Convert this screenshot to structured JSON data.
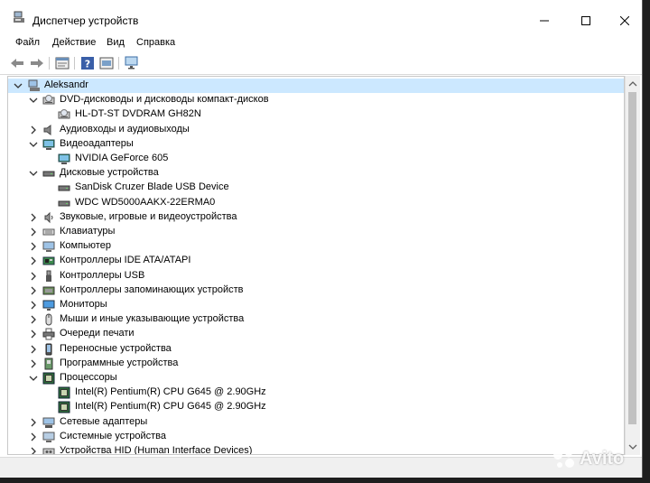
{
  "window": {
    "title": "Диспетчер устройств"
  },
  "menu": [
    "Файл",
    "Действие",
    "Вид",
    "Справка"
  ],
  "toolbar": {
    "icons": [
      "back-arrow-icon",
      "forward-arrow-icon",
      "properties-icon",
      "help-icon",
      "update-driver-icon",
      "scan-monitor-icon"
    ]
  },
  "tree": {
    "root": "Aleksandr",
    "rows": [
      {
        "label": "DVD-дисководы и дисководы компакт-дисков",
        "level": 1,
        "expanded": true,
        "icon": "dvd-drive-icon"
      },
      {
        "label": "HL-DT-ST DVDRAM GH82N",
        "level": 2,
        "icon": "dvd-drive-icon"
      },
      {
        "label": "Аудиовходы и аудиовыходы",
        "level": 1,
        "expanded": false,
        "icon": "speaker-icon"
      },
      {
        "label": "Видеоадаптеры",
        "level": 1,
        "expanded": true,
        "icon": "display-adapter-icon"
      },
      {
        "label": "NVIDIA GeForce 605",
        "level": 2,
        "icon": "display-adapter-icon"
      },
      {
        "label": "Дисковые устройства",
        "level": 1,
        "expanded": true,
        "icon": "disk-drive-icon"
      },
      {
        "label": "SanDisk Cruzer Blade USB Device",
        "level": 2,
        "icon": "disk-drive-icon"
      },
      {
        "label": "WDC WD5000AAKX-22ERMA0",
        "level": 2,
        "icon": "disk-drive-icon"
      },
      {
        "label": "Звуковые, игровые и видеоустройства",
        "level": 1,
        "expanded": false,
        "icon": "sound-icon"
      },
      {
        "label": "Клавиатуры",
        "level": 1,
        "expanded": false,
        "icon": "keyboard-icon"
      },
      {
        "label": "Компьютер",
        "level": 1,
        "expanded": false,
        "icon": "computer-icon"
      },
      {
        "label": "Контроллеры IDE ATA/ATAPI",
        "level": 1,
        "expanded": false,
        "icon": "ide-controller-icon"
      },
      {
        "label": "Контроллеры USB",
        "level": 1,
        "expanded": false,
        "icon": "usb-icon"
      },
      {
        "label": "Контроллеры запоминающих устройств",
        "level": 1,
        "expanded": false,
        "icon": "storage-controller-icon"
      },
      {
        "label": "Мониторы",
        "level": 1,
        "expanded": false,
        "icon": "monitor-icon"
      },
      {
        "label": "Мыши и иные указывающие устройства",
        "level": 1,
        "expanded": false,
        "icon": "mouse-icon"
      },
      {
        "label": "Очереди печати",
        "level": 1,
        "expanded": false,
        "icon": "printer-icon"
      },
      {
        "label": "Переносные устройства",
        "level": 1,
        "expanded": false,
        "icon": "portable-device-icon"
      },
      {
        "label": "Программные устройства",
        "level": 1,
        "expanded": false,
        "icon": "software-device-icon"
      },
      {
        "label": "Процессоры",
        "level": 1,
        "expanded": true,
        "icon": "processor-icon"
      },
      {
        "label": "Intel(R) Pentium(R) CPU G645 @ 2.90GHz",
        "level": 2,
        "icon": "processor-icon"
      },
      {
        "label": "Intel(R) Pentium(R) CPU G645 @ 2.90GHz",
        "level": 2,
        "icon": "processor-icon"
      },
      {
        "label": "Сетевые адаптеры",
        "level": 1,
        "expanded": false,
        "icon": "network-adapter-icon"
      },
      {
        "label": "Системные устройства",
        "level": 1,
        "expanded": false,
        "icon": "system-device-icon"
      },
      {
        "label": "Устройства HID (Human Interface Devices)",
        "level": 1,
        "expanded": false,
        "icon": "hid-icon"
      }
    ]
  },
  "watermark": {
    "text": "Avito"
  }
}
